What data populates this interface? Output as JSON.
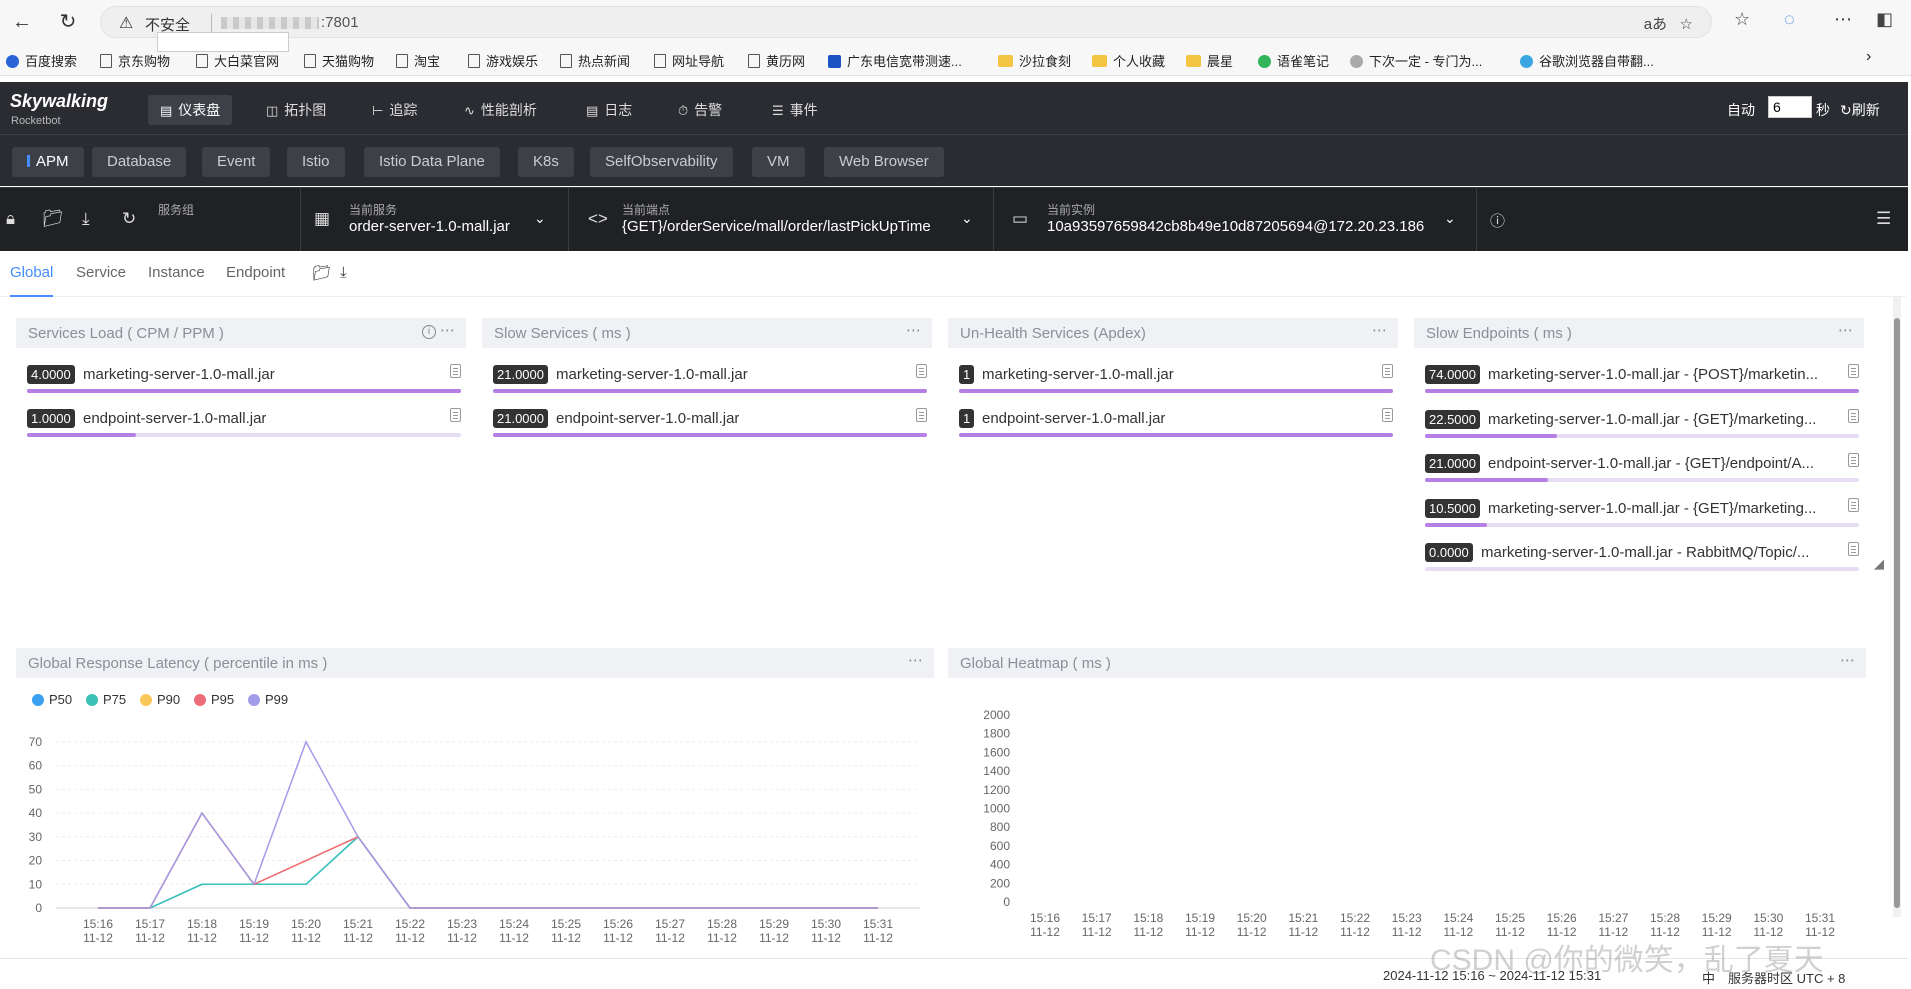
{
  "browser": {
    "back_icon": "arrow-left-icon",
    "reload_icon": "reload-icon",
    "insecure_label": "不安全",
    "url_suffix": ":7801",
    "reader_label": "aあ"
  },
  "bookmarks": [
    {
      "label": "百度搜索"
    },
    {
      "label": "京东购物"
    },
    {
      "label": "大白菜官网"
    },
    {
      "label": "天猫购物"
    },
    {
      "label": "淘宝"
    },
    {
      "label": "游戏娱乐"
    },
    {
      "label": "热点新闻"
    },
    {
      "label": "网址导航"
    },
    {
      "label": "黄历网"
    },
    {
      "label": "广东电信宽带测速..."
    },
    {
      "label": "沙拉食刻"
    },
    {
      "label": "个人收藏"
    },
    {
      "label": "晨星"
    },
    {
      "label": "语雀笔记"
    },
    {
      "label": "下次一定 - 专门为..."
    },
    {
      "label": "谷歌浏览器自带翻..."
    }
  ],
  "app": {
    "logo": "Skywalking",
    "logo_sub": "Rocketbot",
    "nav": [
      {
        "label": "仪表盘",
        "icon": "dashboard-icon"
      },
      {
        "label": "拓扑图",
        "icon": "topology-icon"
      },
      {
        "label": "追踪",
        "icon": "trace-icon"
      },
      {
        "label": "性能剖析",
        "icon": "profile-icon"
      },
      {
        "label": "日志",
        "icon": "log-icon"
      },
      {
        "label": "告警",
        "icon": "alarm-icon"
      },
      {
        "label": "事件",
        "icon": "event-icon"
      }
    ],
    "auto_label": "自动",
    "auto_value": "6",
    "sec_label": "秒",
    "refresh_label": "刷新"
  },
  "layers": [
    "APM",
    "Database",
    "Event",
    "Istio",
    "Istio Data Plane",
    "K8s",
    "SelfObservability",
    "VM",
    "Web Browser"
  ],
  "selectors": {
    "group_label": "服务组",
    "service_label": "当前服务",
    "service_value": "order-server-1.0-mall.jar",
    "endpoint_label": "当前端点",
    "endpoint_value": "{GET}/orderService/mall/order/lastPickUpTime",
    "instance_label": "当前实例",
    "instance_value": "10a93597659842cb8b49e10d87205694@172.20.23.186"
  },
  "sub_tabs": [
    "Global",
    "Service",
    "Instance",
    "Endpoint"
  ],
  "widgets": {
    "services_load": {
      "title": "Services Load ( CPM / PPM )",
      "rows": [
        {
          "value": "4.0000",
          "name": "marketing-server-1.0-mall.jar",
          "fill": 1.0
        },
        {
          "value": "1.0000",
          "name": "endpoint-server-1.0-mall.jar",
          "fill": 0.25
        }
      ]
    },
    "slow_services": {
      "title": "Slow Services ( ms )",
      "rows": [
        {
          "value": "21.0000",
          "name": "marketing-server-1.0-mall.jar",
          "fill": 1.0
        },
        {
          "value": "21.0000",
          "name": "endpoint-server-1.0-mall.jar",
          "fill": 1.0
        }
      ]
    },
    "unhealth_services": {
      "title": "Un-Health Services (Apdex)",
      "rows": [
        {
          "value": "1",
          "name": "marketing-server-1.0-mall.jar",
          "fill": 1.0
        },
        {
          "value": "1",
          "name": "endpoint-server-1.0-mall.jar",
          "fill": 1.0
        }
      ]
    },
    "slow_endpoints": {
      "title": "Slow Endpoints ( ms )",
      "rows": [
        {
          "value": "74.0000",
          "name": "marketing-server-1.0-mall.jar - {POST}/marketin...",
          "fill": 1.0
        },
        {
          "value": "22.5000",
          "name": "marketing-server-1.0-mall.jar - {GET}/marketing...",
          "fill": 0.304
        },
        {
          "value": "21.0000",
          "name": "endpoint-server-1.0-mall.jar - {GET}/endpoint/A...",
          "fill": 0.284
        },
        {
          "value": "10.5000",
          "name": "marketing-server-1.0-mall.jar - {GET}/marketing...",
          "fill": 0.142
        },
        {
          "value": "0.0000",
          "name": "marketing-server-1.0-mall.jar - RabbitMQ/Topic/...",
          "fill": 0.0
        }
      ]
    },
    "latency": {
      "title": "Global Response Latency ( percentile in ms )"
    },
    "heatmap": {
      "title": "Global Heatmap ( ms )"
    }
  },
  "chart_data": [
    {
      "type": "line",
      "title": "Global Response Latency ( percentile in ms )",
      "x": [
        "15:16\n11-12",
        "15:17\n11-12",
        "15:18\n11-12",
        "15:19\n11-12",
        "15:20\n11-12",
        "15:21\n11-12",
        "15:22\n11-12",
        "15:23\n11-12",
        "15:24\n11-12",
        "15:25\n11-12",
        "15:26\n11-12",
        "15:27\n11-12",
        "15:28\n11-12",
        "15:29\n11-12",
        "15:30\n11-12",
        "15:31\n11-12"
      ],
      "x_time": [
        "15:16",
        "15:17",
        "15:18",
        "15:19",
        "15:20",
        "15:21",
        "15:22",
        "15:23",
        "15:24",
        "15:25",
        "15:26",
        "15:27",
        "15:28",
        "15:29",
        "15:30",
        "15:31"
      ],
      "x_date": "11-12",
      "yticks": [
        0,
        10,
        20,
        30,
        40,
        50,
        60,
        70
      ],
      "ylim": [
        0,
        75
      ],
      "grid": true,
      "legend": "top-left",
      "series": [
        {
          "name": "P50",
          "color": "#3ba0f0",
          "values": [
            0,
            0,
            10,
            10,
            10,
            30,
            0,
            0,
            0,
            0,
            0,
            0,
            0,
            0,
            0,
            0
          ]
        },
        {
          "name": "P75",
          "color": "#3bc3b8",
          "values": [
            0,
            0,
            10,
            10,
            10,
            30,
            0,
            0,
            0,
            0,
            0,
            0,
            0,
            0,
            0,
            0
          ]
        },
        {
          "name": "P90",
          "color": "#f8c85b",
          "values": [
            0,
            0,
            40,
            10,
            20,
            30,
            0,
            0,
            0,
            0,
            0,
            0,
            0,
            0,
            0,
            0
          ]
        },
        {
          "name": "P95",
          "color": "#ee6b7a",
          "values": [
            0,
            0,
            40,
            10,
            20,
            30,
            0,
            0,
            0,
            0,
            0,
            0,
            0,
            0,
            0,
            0
          ]
        },
        {
          "name": "P99",
          "color": "#a29be8",
          "values": [
            0,
            0,
            40,
            10,
            70,
            30,
            0,
            0,
            0,
            0,
            0,
            0,
            0,
            0,
            0,
            0
          ]
        }
      ]
    },
    {
      "type": "heatmap",
      "title": "Global Heatmap ( ms )",
      "x": [
        "15:16\n11-12",
        "15:17\n11-12",
        "15:18\n11-12",
        "15:19\n11-12",
        "15:20\n11-12",
        "15:21\n11-12",
        "15:22\n11-12",
        "15:23\n11-12",
        "15:24\n11-12",
        "15:25\n11-12",
        "15:26\n11-12",
        "15:27\n11-12",
        "15:28\n11-12",
        "15:29\n11-12",
        "15:30\n11-12",
        "15:31\n11-12"
      ],
      "x_time": [
        "15:16",
        "15:17",
        "15:18",
        "15:19",
        "15:20",
        "15:21",
        "15:22",
        "15:23",
        "15:24",
        "15:25",
        "15:26",
        "15:27",
        "15:28",
        "15:29",
        "15:30",
        "15:31"
      ],
      "x_date": "11-12",
      "yticks": [
        0,
        200,
        400,
        600,
        800,
        1000,
        1200,
        1400,
        1600,
        1800,
        2000
      ],
      "ylim": [
        0,
        2000
      ],
      "values": []
    }
  ],
  "footer": {
    "time_range": "2024-11-12 15:16 ~ 2024-11-12 15:31",
    "lang": "中",
    "timezone": "服务器时区 UTC + 8"
  },
  "watermark": "CSDN @你的微笑，乱了夏天"
}
